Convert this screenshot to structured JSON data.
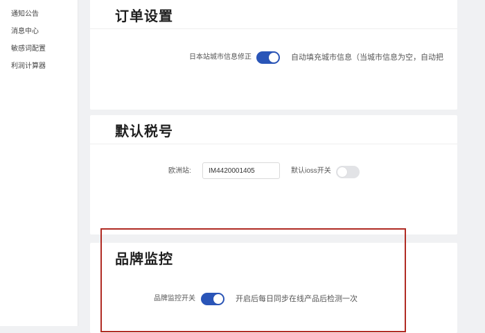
{
  "sidebar": {
    "cut_item": "…",
    "items": [
      {
        "label": "通知公告"
      },
      {
        "label": "消息中心"
      },
      {
        "label": "敏感词配置"
      },
      {
        "label": "利润计算器"
      }
    ]
  },
  "order_settings": {
    "title": "订单设置",
    "city_fix_label": "日本站城市信息修正",
    "city_fix_enabled": true,
    "city_fix_hint": "自动填充城市信息（当城市信息为空，自动把"
  },
  "default_tax": {
    "title": "默认税号",
    "eu_label": "欧洲站:",
    "eu_value": "IM4420001405",
    "ioss_label": "默认ioss开关",
    "ioss_enabled": false
  },
  "brand_monitor": {
    "title": "品牌监控",
    "switch_label": "品牌监控开关",
    "switch_enabled": true,
    "hint": "开启后每日同步在线产品后检测一次"
  },
  "colors": {
    "switch_on": "#2a55b8",
    "switch_off": "#e2e3e6",
    "highlight_border": "#b02a22",
    "page_bg": "#f0f1f3"
  }
}
